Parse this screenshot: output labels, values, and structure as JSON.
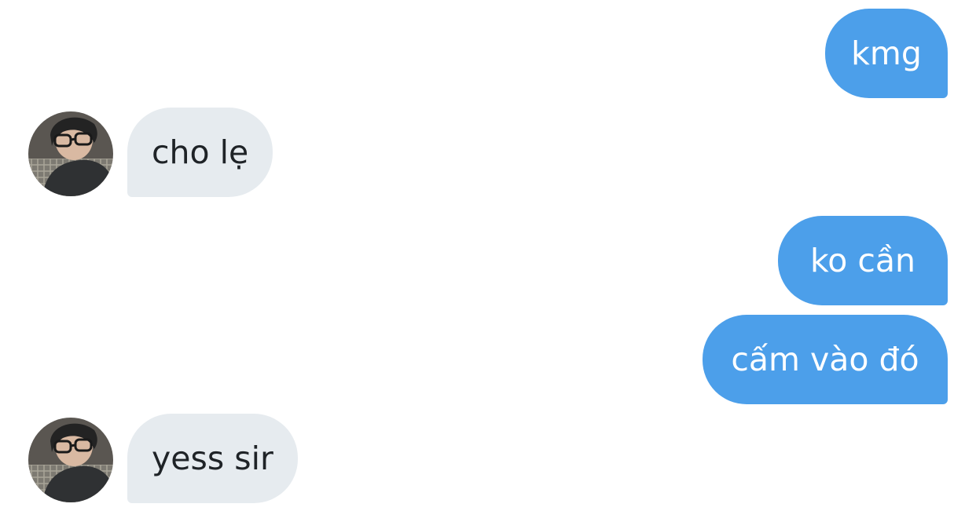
{
  "conversation": {
    "messages": [
      {
        "direction": "outgoing",
        "text": "kmg"
      },
      {
        "direction": "incoming",
        "text": "cho lẹ",
        "avatar": "user-avatar"
      },
      {
        "direction": "outgoing",
        "text": "ko cần"
      },
      {
        "direction": "outgoing",
        "text": "cấm vào đó"
      },
      {
        "direction": "incoming",
        "text": "yess sir",
        "avatar": "user-avatar"
      }
    ]
  },
  "colors": {
    "outgoing_bubble": "#4c9fea",
    "incoming_bubble": "#e6ebef",
    "background": "#ffffff"
  }
}
